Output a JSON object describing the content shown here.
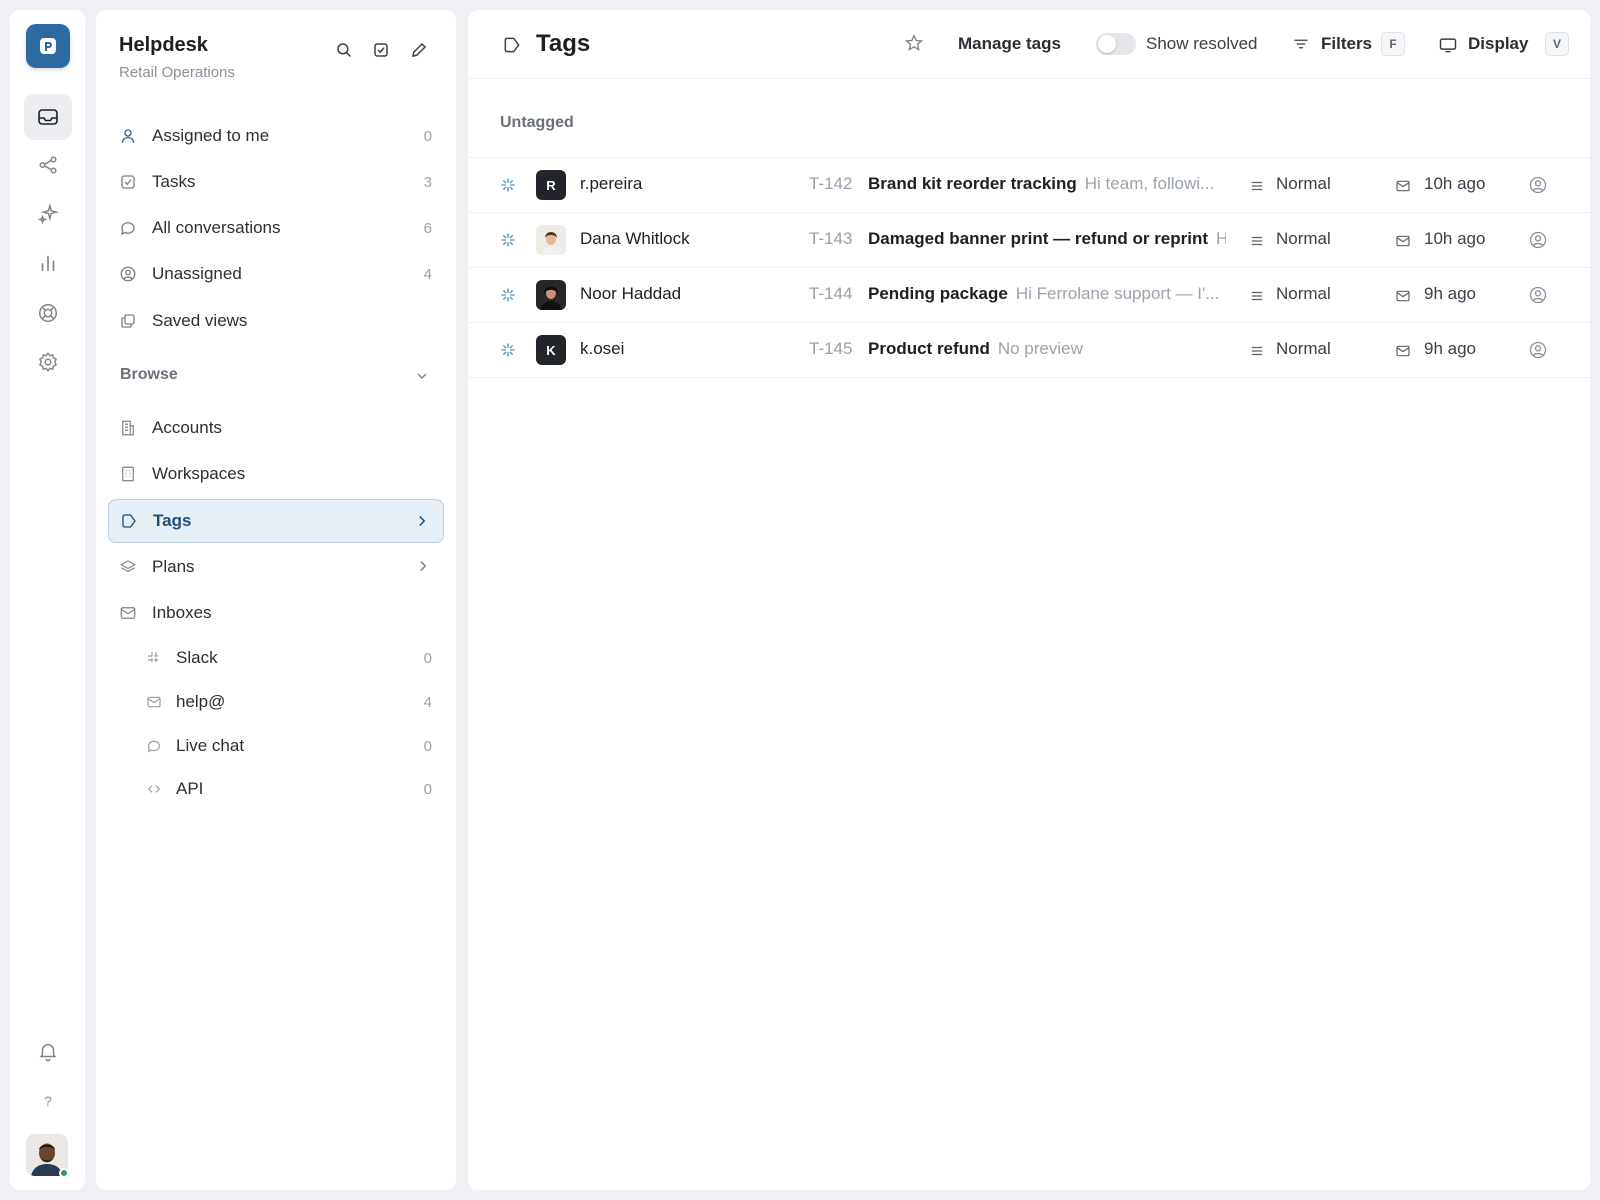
{
  "rail": {
    "logo_letter": "P",
    "items": [
      "inbox-icon",
      "share-icon",
      "sparkles-icon",
      "bar-chart-icon",
      "lifebuoy-icon",
      "settings-icon"
    ],
    "bottom": [
      "bell-icon",
      "help-icon"
    ],
    "help_label": "?"
  },
  "sidebar": {
    "title": "Helpdesk",
    "subtitle": "Retail Operations",
    "nav": [
      {
        "label": "Assigned to me",
        "count": "0",
        "icon": "user-icon"
      },
      {
        "label": "Tasks",
        "count": "3",
        "icon": "checkbox-icon"
      },
      {
        "label": "All conversations",
        "count": "6",
        "icon": "chat-bubble-icon"
      },
      {
        "label": "Unassigned",
        "count": "4",
        "icon": "user-circle-icon"
      },
      {
        "label": "Saved views",
        "count": "",
        "icon": "copy-icon"
      }
    ],
    "browse": {
      "heading": "Browse",
      "items": [
        {
          "label": "Accounts",
          "icon": "building-icon"
        },
        {
          "label": "Workspaces",
          "icon": "office-icon"
        },
        {
          "label": "Tags",
          "icon": "tag-icon",
          "active": true
        },
        {
          "label": "Plans",
          "icon": "layers-icon"
        },
        {
          "label": "Inboxes",
          "icon": "mail-icon"
        }
      ],
      "inboxes": [
        {
          "label": "Slack",
          "count": "0",
          "icon": "slack-icon"
        },
        {
          "label": "help@",
          "count": "4",
          "icon": "mail-icon"
        },
        {
          "label": "Live chat",
          "count": "0",
          "icon": "chat-bubble-icon"
        },
        {
          "label": "API",
          "count": "0",
          "icon": "code-icon"
        }
      ]
    }
  },
  "topbar": {
    "title": "Tags",
    "manage_tags": "Manage tags",
    "show_resolved": "Show resolved",
    "show_resolved_on": false,
    "filters": "Filters",
    "filters_key": "F",
    "display": "Display",
    "display_key": "V"
  },
  "group": {
    "heading": "Untagged",
    "rows": [
      {
        "avatar": "R",
        "name": "r.pereira",
        "id": "T-142",
        "subject": "Brand kit reorder tracking",
        "preview": "Hi team, followi...",
        "priority": "Normal",
        "time": "10h ago"
      },
      {
        "avatar": "",
        "name": "Dana Whitlock",
        "id": "T-143",
        "subject": "Damaged banner print — refund or reprint",
        "preview": "Hi",
        "priority": "Normal",
        "time": "10h ago"
      },
      {
        "avatar": "",
        "name": "Noor Haddad",
        "id": "T-144",
        "subject": "Pending package",
        "preview": "Hi Ferrolane support — I'...",
        "priority": "Normal",
        "time": "9h ago"
      },
      {
        "avatar": "K",
        "name": "k.osei",
        "id": "T-145",
        "subject": "Product refund",
        "preview": "No preview",
        "priority": "Normal",
        "time": "9h ago"
      }
    ]
  },
  "colors": {
    "accent": "#2c6aa0",
    "active_bg": "#e6eef6",
    "active_border": "#b9cde1",
    "online": "#2f9e69"
  }
}
